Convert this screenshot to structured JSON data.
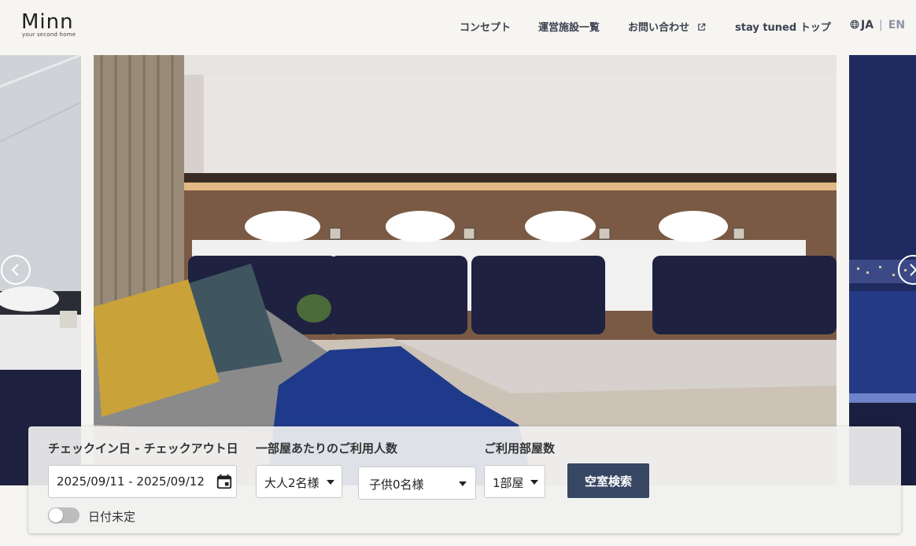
{
  "header": {
    "logo": {
      "word": "Minn",
      "tagline": "your second home"
    },
    "nav": [
      {
        "label": "コンセプト"
      },
      {
        "label": "運営施設一覧"
      },
      {
        "label": "お問い合わせ",
        "icon": "external-link-icon"
      },
      {
        "label": "stay tuned トップ"
      }
    ],
    "lang": {
      "icon": "globe-icon",
      "current": "JA",
      "separator": "|",
      "other": "EN"
    }
  },
  "slider": {
    "prev_icon": "chevron-left-icon",
    "next_icon": "chevron-right-icon"
  },
  "booking": {
    "date_label": "チェックイン日 - チェックアウト日",
    "guests_label": "一部屋あたりのご利用人数",
    "rooms_label": "ご利用部屋数",
    "date_value": "2025/09/11 - 2025/09/12",
    "date_icon": "calendar-icon",
    "adults_value": "大人2名様",
    "children_value": "子供0名様",
    "rooms_value": "1部屋",
    "search_label": "空室検索",
    "undecided_label": "日付未定",
    "undecided_on": false
  },
  "colors": {
    "background": "#f7f5f1",
    "nav_text": "#3a4150",
    "accent_button": "#374663",
    "bedding_navy": "#1e2240"
  }
}
